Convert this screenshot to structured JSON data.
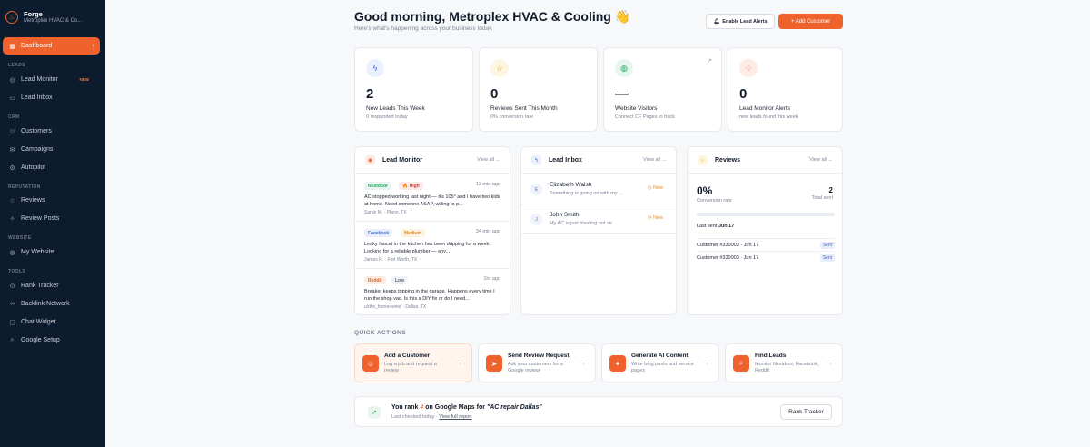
{
  "brand": {
    "name": "Forge",
    "subtitle": "Metroplex HVAC & Co..."
  },
  "sidebar": {
    "dashboard": "Dashboard",
    "sections": {
      "leads": "LEADS",
      "crm": "CRM",
      "reputation": "REPUTATION",
      "website": "WEBSITE",
      "tools": "TOOLS"
    },
    "items": {
      "lead_monitor": "Lead Monitor",
      "lead_monitor_badge": "NEW",
      "lead_inbox": "Lead Inbox",
      "customers": "Customers",
      "campaigns": "Campaigns",
      "autopilot": "Autopilot",
      "reviews": "Reviews",
      "review_posts": "Review Posts",
      "my_website": "My Website",
      "rank_tracker": "Rank Tracker",
      "backlink_network": "Backlink Network",
      "chat_widget": "Chat Widget",
      "google_setup": "Google Setup"
    }
  },
  "header": {
    "greeting": "Good morning, Metroplex HVAC & Cooling 👋",
    "subtitle": "Here's what's happening across your business today.",
    "alerts_button": "Enable Lead Alerts",
    "add_button": "+ Add Customer"
  },
  "stats": [
    {
      "value": "2",
      "label": "New Leads This Week",
      "sub": "0 responded today"
    },
    {
      "value": "0",
      "label": "Reviews Sent This Month",
      "sub": "0% conversion rate"
    },
    {
      "value": "—",
      "label": "Website Visitors",
      "sub": "Connect CF Pages to track"
    },
    {
      "value": "0",
      "label": "Lead Monitor Alerts",
      "sub": "new leads found this week"
    }
  ],
  "lead_monitor": {
    "title": "Lead Monitor",
    "view_all": "View all →",
    "items": [
      {
        "source": "Nextdoor",
        "priority": "🔥 High",
        "age": "12 min ago",
        "text": "AC stopped working last night — it's 105° and I have two kids at home. Need someone ASAP, willing to p...",
        "location": "Sarah M. · Plano, TX"
      },
      {
        "source": "Facebook",
        "priority": "Medium",
        "age": "34 min ago",
        "text": "Leaky faucet in the kitchen has been dripping for a week. Looking for a reliable plumber — any...",
        "location": "James R. · Fort Worth, TX"
      },
      {
        "source": "Reddit",
        "priority": "Low",
        "age": "1hr ago",
        "text": "Breaker keeps tripping in the garage. Happens every time I run the shop vac. Is this a DIY fix or do I need...",
        "location": "u/dfw_homeowner · Dallas, TX"
      }
    ]
  },
  "lead_inbox": {
    "title": "Lead Inbox",
    "view_all": "View all →",
    "items": [
      {
        "initial": "E",
        "name": "Elizabeth Walsh",
        "preview": "Something is going on with my ...",
        "status": "New"
      },
      {
        "initial": "J",
        "name": "John Smith",
        "preview": "My AC is just blasting hot air",
        "status": "New"
      }
    ]
  },
  "reviews": {
    "title": "Reviews",
    "view_all": "View all →",
    "conversion": "0%",
    "conversion_label": "Conversion rate",
    "total": "2",
    "total_label": "Total sent",
    "progress_pct": 0,
    "last_sent_label": "Last sent",
    "last_sent_date": "Jun 17",
    "items": [
      {
        "customer": "Customer #330003 · Jun 17",
        "status": "Sent"
      },
      {
        "customer": "Customer #330003 · Jun 17",
        "status": "Sent"
      }
    ]
  },
  "quick_actions": {
    "label": "QUICK ACTIONS",
    "items": [
      {
        "title": "Add a Customer",
        "sub": "Log a job and request a review"
      },
      {
        "title": "Send Review Request",
        "sub": "Ask your customers for a Google review"
      },
      {
        "title": "Generate AI Content",
        "sub": "Write blog posts and service pages"
      },
      {
        "title": "Find Leads",
        "sub": "Monitor Nextdoor, Facebook, Reddit"
      }
    ]
  },
  "rank": {
    "prefix": "You rank",
    "rank_value": "#",
    "middle": "on Google Maps for",
    "keyword": "\"AC repair Dallas\"",
    "sub": "Last checked today ·",
    "link": "View full report",
    "button": "Rank Tracker"
  },
  "colors": {
    "accent": "#f0622b",
    "sidebar": "#0d1b2e"
  }
}
